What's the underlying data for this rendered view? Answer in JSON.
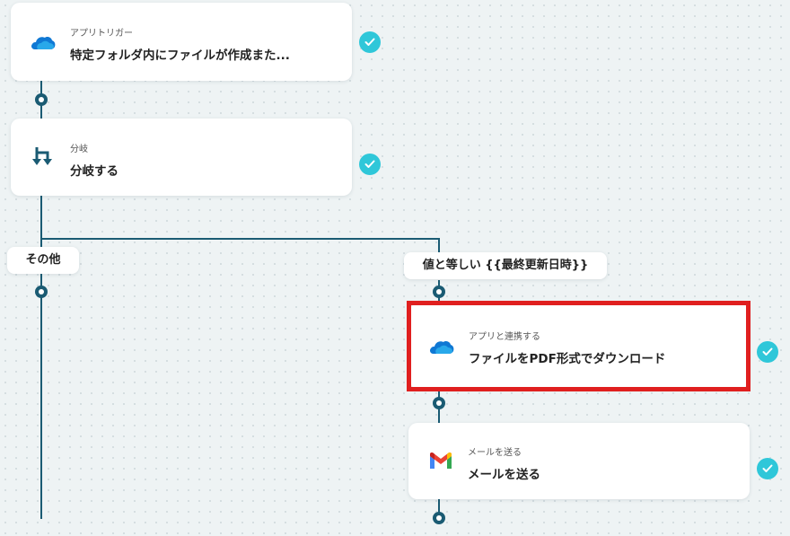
{
  "steps": {
    "trigger": {
      "subtitle": "アプリトリガー",
      "title": "特定フォルダ内にファイルが作成また..."
    },
    "branch": {
      "subtitle": "分岐",
      "title": "分岐する"
    },
    "download": {
      "subtitle": "アプリと連携する",
      "title": "ファイルをPDF形式でダウンロード"
    },
    "mail": {
      "subtitle": "メールを送る",
      "title": "メールを送る"
    }
  },
  "branches": {
    "other_label": "その他",
    "equals_label": "値と等しい {{最終更新日時}}"
  },
  "icons": {
    "trigger": "onedrive-cloud-icon",
    "branch": "branch-icon",
    "download": "onedrive-cloud-icon",
    "mail": "gmail-icon",
    "status": "check-icon"
  },
  "colors": {
    "connector": "#1a5b73",
    "check": "#2fc7d9",
    "highlight": "#e01f1f",
    "onedrive": "#0f78d4"
  }
}
